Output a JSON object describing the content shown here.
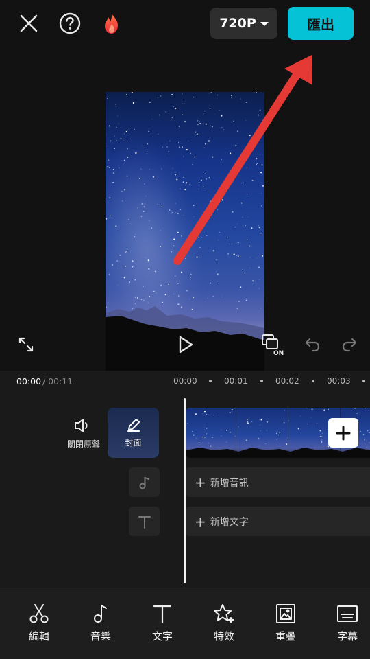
{
  "header": {
    "resolution_label": "720P",
    "export_label": "匯出",
    "icons": [
      "close-icon",
      "help-icon",
      "flame-icon"
    ],
    "colors": {
      "export_bg": "#05c2d6",
      "annotation_arrow": "#e53935"
    }
  },
  "playback": {
    "icons": [
      "fullscreen-icon",
      "play-icon",
      "subtitle-toggle-icon",
      "undo-icon",
      "redo-icon"
    ]
  },
  "timeline": {
    "current_time": "00:00",
    "total_time": " / 00:11",
    "ticks": [
      "00:00",
      "00:01",
      "00:02",
      "00:03"
    ]
  },
  "tracks": {
    "mute_label": "關閉原聲",
    "cover_label": "封面",
    "add_audio_label": "新增音訊",
    "add_text_label": "新增文字"
  },
  "toolbar": {
    "items": [
      {
        "label": "編輯",
        "icon": "scissors-icon"
      },
      {
        "label": "音樂",
        "icon": "music-note-icon"
      },
      {
        "label": "文字",
        "icon": "text-icon"
      },
      {
        "label": "特效",
        "icon": "star-effects-icon"
      },
      {
        "label": "重疊",
        "icon": "overlay-icon"
      },
      {
        "label": "字幕",
        "icon": "subtitles-icon"
      }
    ]
  }
}
